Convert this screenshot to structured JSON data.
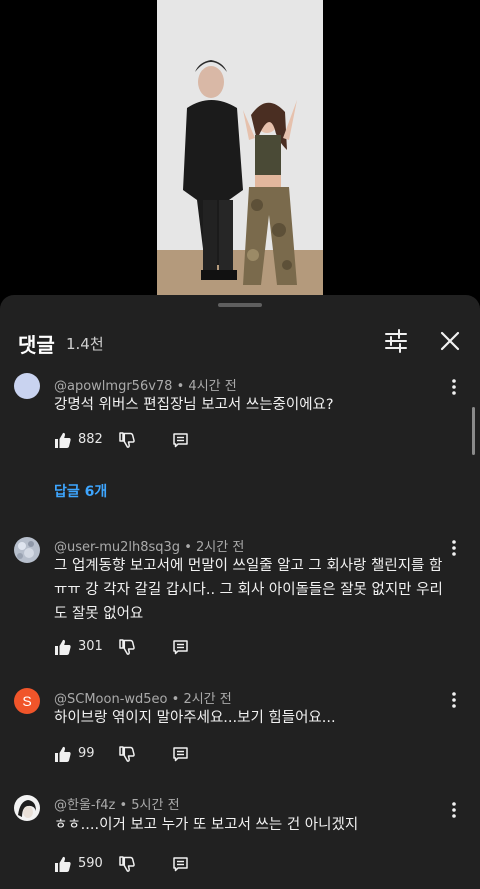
{
  "sheet": {
    "title": "댓글",
    "count": "1.4천"
  },
  "comments": [
    {
      "author": "@apowlmgr56v78",
      "sep": "•",
      "time": "4시간 전",
      "text": "강명석 위버스 편집장님 보고서 쓰는중이에요?",
      "likes": "882",
      "replies": "답글 6개"
    },
    {
      "author": "@user-mu2lh8sq3g",
      "sep": "•",
      "time": "2시간 전",
      "lines": [
        "그 업계동향 보고서에 먼말이 쓰일줄 알고 그 회사랑 챌린지를 함",
        "ㅠㅠ 강 각자 갈길 갑시다.. 그 회사 아이돌들은  잘못 없지만 우리",
        "도 잘못 없어요"
      ],
      "likes": "301"
    },
    {
      "author": "@SCMoon-wd5eo",
      "sep": "•",
      "time": "2시간 전",
      "avatar_letter": "S",
      "text": "하이브랑 엮이지 말아주세요...보기 힘들어요...",
      "likes": "99"
    },
    {
      "author": "@한울-f4z",
      "sep": "•",
      "time": "5시간 전",
      "text": "ㅎㅎ....이거 보고 누가 또 보고서 쓰는 건 아니겠지",
      "likes": "590"
    }
  ],
  "colors": {
    "sheet_bg": "#212121",
    "reply_link": "#3ea6ff",
    "avatar_orange": "#f0552a"
  }
}
